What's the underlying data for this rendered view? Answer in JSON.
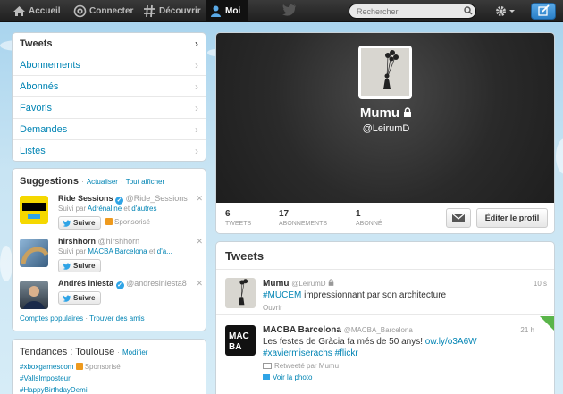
{
  "topbar": {
    "nav": [
      {
        "label": "Accueil",
        "icon": "home-icon"
      },
      {
        "label": "Connecter",
        "icon": "at-icon"
      },
      {
        "label": "Découvrir",
        "icon": "hash-icon"
      },
      {
        "label": "Moi",
        "icon": "person-icon"
      }
    ],
    "search_placeholder": "Rechercher"
  },
  "menu": {
    "items": [
      "Tweets",
      "Abonnements",
      "Abonnés",
      "Favoris",
      "Demandes",
      "Listes"
    ]
  },
  "suggestions": {
    "title": "Suggestions",
    "refresh": "Actualiser",
    "view_all": "Tout afficher",
    "separator": "·",
    "follow_label": "Suivre",
    "promoted_label": "Sponsorisé",
    "people": [
      {
        "name": "Ride Sessions",
        "handle": "@Ride_Sessions",
        "verified": true,
        "sub_prefix": "Suivi par ",
        "sub_link1": "Adrénaline",
        "sub_mid": " et ",
        "sub_link2": "d'autres",
        "promoted": true
      },
      {
        "name": "hirshhorn",
        "handle": "@hirshhorn",
        "verified": false,
        "sub_prefix": "Suivi par ",
        "sub_link1": "MACBA Barcelona",
        "sub_mid": " et ",
        "sub_link2": "d'a...",
        "promoted": false
      },
      {
        "name": "Andrés Iniesta",
        "handle": "@andresiniesta8",
        "verified": true,
        "promoted": false
      }
    ],
    "footer_link1": "Comptes populaires",
    "footer_link2": "Trouver des amis"
  },
  "trends": {
    "title": "Tendances : Toulouse",
    "modify": "Modifier",
    "items": [
      "#xboxgamescom",
      "#VallsImposteur",
      "#HappyBirthdayDemi"
    ]
  },
  "profile": {
    "name": "Mumu",
    "handle": "@LeirumD",
    "stats": [
      {
        "num": "6",
        "label": "TWEETS"
      },
      {
        "num": "17",
        "label": "ABONNEMENTS"
      },
      {
        "num": "1",
        "label": "ABONNÉ"
      }
    ],
    "edit_label": "Éditer le profil"
  },
  "tweets": {
    "title": "Tweets",
    "items": [
      {
        "name": "Mumu",
        "handle": "@LeirumD",
        "time": "10 s",
        "hashtag": "#MUCEM",
        "text": " impressionnant par son architecture",
        "action": "Ouvrir"
      },
      {
        "name": "MACBA Barcelona",
        "handle": "@MACBA_Barcelona",
        "time": "21 h",
        "text": "Les festes de Gràcia fa més de 50 anys! ",
        "link": "ow.ly/o3A6W",
        "hashtags": "#xaviermiserachs #flickr",
        "retweet": "Retweeté par Mumu",
        "action": "Voir la photo"
      }
    ]
  },
  "colors": {
    "link": "#0084b4",
    "sky": "#c0deed",
    "topbar": "#222222"
  }
}
